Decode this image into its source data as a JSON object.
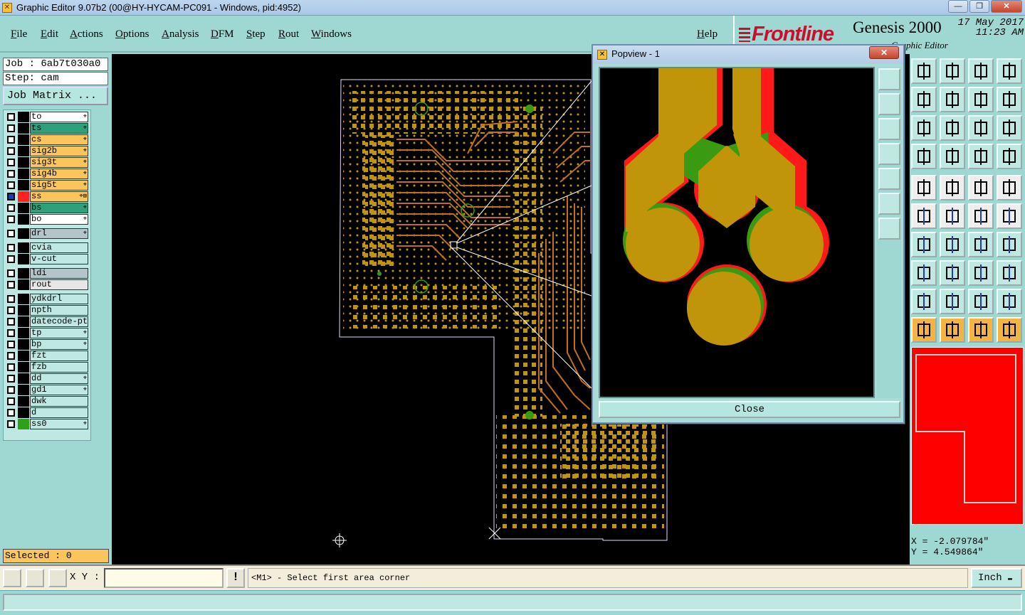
{
  "window": {
    "title": "Graphic Editor 9.07b2 (00@HY-HYCAM-PC091 - Windows, pid:4952)",
    "buttons": [
      "—",
      "❐",
      "✕"
    ]
  },
  "menu": [
    "File",
    "Edit",
    "Actions",
    "Options",
    "Analysis",
    "DFM",
    "Step",
    "Rout",
    "Windows"
  ],
  "help": "Help",
  "brand": {
    "logo": "Frontline",
    "product": "Genesis 2000",
    "subtitle": "Graphic Editor",
    "date": "17 May 2017",
    "time": "11:23 AM"
  },
  "job": {
    "job_label": "Job : 6ab7t030a0",
    "step_label": "Step: cam",
    "matrix_button": "Job Matrix ..."
  },
  "layers": [
    {
      "name": "to",
      "color": "#ffffff",
      "swatch": "#000000",
      "flag": "⌖"
    },
    {
      "name": "ts",
      "color": "#2fa07a",
      "swatch": "#000000",
      "flag": "⌖"
    },
    {
      "name": "cs",
      "color": "#f9c55c",
      "swatch": "#000000",
      "flag": "⌖"
    },
    {
      "name": "sig2b",
      "color": "#f9c55c",
      "swatch": "#000000",
      "flag": "⌖"
    },
    {
      "name": "sig3t",
      "color": "#f9c55c",
      "swatch": "#000000",
      "flag": "⌖"
    },
    {
      "name": "sig4b",
      "color": "#f9c55c",
      "swatch": "#000000",
      "flag": "⌖"
    },
    {
      "name": "sig5t",
      "color": "#f9c55c",
      "swatch": "#000000",
      "flag": "⌖"
    },
    {
      "name": "ss",
      "color": "#f9c55c",
      "swatch": "#ff2020",
      "flag": "⌖⊞",
      "active": true
    },
    {
      "name": "bs",
      "color": "#2fa07a",
      "swatch": "#000000",
      "flag": "⌖"
    },
    {
      "name": "bo",
      "color": "#ffffff",
      "swatch": "#000000",
      "flag": "⌖"
    },
    {
      "name": "drl",
      "color": "#b4c4c8",
      "swatch": "#000000",
      "flag": "⌖",
      "gap": true
    },
    {
      "name": "cvia",
      "color": "#bfe8e3",
      "swatch": "#000000",
      "flag": "",
      "gap": true
    },
    {
      "name": "v-cut",
      "color": "#bfe8e3",
      "swatch": "#000000",
      "flag": ""
    },
    {
      "name": "ldi",
      "color": "#b4c4c8",
      "swatch": "#000000",
      "flag": "",
      "gap": true
    },
    {
      "name": "rout",
      "color": "#e6e6e6",
      "swatch": "#000000",
      "flag": ""
    },
    {
      "name": "ydkdrl",
      "color": "#bfe8e3",
      "swatch": "#000000",
      "flag": "",
      "gap": true
    },
    {
      "name": "npth",
      "color": "#bfe8e3",
      "swatch": "#000000",
      "flag": ""
    },
    {
      "name": "datecode-pt",
      "color": "#bfe8e3",
      "swatch": "#000000",
      "flag": ""
    },
    {
      "name": "tp",
      "color": "#bfe8e3",
      "swatch": "#000000",
      "flag": "⌖"
    },
    {
      "name": "bp",
      "color": "#bfe8e3",
      "swatch": "#000000",
      "flag": "⌖"
    },
    {
      "name": "fzt",
      "color": "#bfe8e3",
      "swatch": "#000000",
      "flag": ""
    },
    {
      "name": "fzb",
      "color": "#bfe8e3",
      "swatch": "#000000",
      "flag": ""
    },
    {
      "name": "dd",
      "color": "#bfe8e3",
      "swatch": "#000000",
      "flag": "⌖"
    },
    {
      "name": "gd1",
      "color": "#bfe8e3",
      "swatch": "#000000",
      "flag": "⌖"
    },
    {
      "name": "dwk",
      "color": "#bfe8e3",
      "swatch": "#000000",
      "flag": ""
    },
    {
      "name": "d",
      "color": "#bfe8e3",
      "swatch": "#000000",
      "flag": ""
    },
    {
      "name": "ss0",
      "color": "#bfe8e3",
      "swatch": "#2fa01a",
      "flag": "⌖"
    }
  ],
  "selected": "Selected : 0",
  "popview": {
    "title": "Popview - 1",
    "close_label": "Close",
    "close_x": "✕"
  },
  "coords": {
    "x": "X = -2.079784\"",
    "y": "Y = 4.549864\""
  },
  "bottom": {
    "xy_label": "X Y :",
    "xy_value": "",
    "message": "<M1> - Select first area corner",
    "unit": "Inch"
  },
  "colors": {
    "panel": "#9fd8d2",
    "copper": "#c0950a",
    "mask": "#ff1a1a",
    "green": "#3a9a12"
  }
}
